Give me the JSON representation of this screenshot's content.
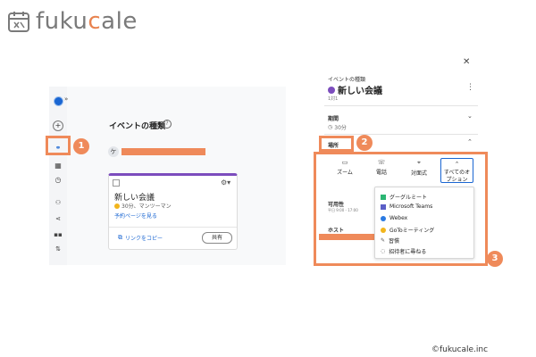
{
  "brand": {
    "logo_text_prefix": "fuku",
    "logo_text_accent": "c",
    "logo_text_suffix": "ale",
    "accent_color": "#ef8a5a",
    "copyright": "©fukucale.inc"
  },
  "left": {
    "page_title": "イベントの種類",
    "avatar_initial": "ケ",
    "card": {
      "title": "新しい会議",
      "meta": "30分、マンツーマン",
      "booking_link": "予約ページを見る",
      "copy_link": "リンクをコピー",
      "share_button": "共有",
      "accent_color": "#7c4dbd"
    },
    "rail_icons": [
      "avatar-icon",
      "plus-icon",
      "link-icon",
      "calendar-icon",
      "clock-icon",
      "people-icon",
      "share-icon",
      "apps-icon",
      "settings-icon"
    ]
  },
  "right": {
    "event_type_label": "イベントの種類",
    "event_title": "新しい会議",
    "event_sub": "1対1",
    "duration_label": "期間",
    "duration_value": "30分",
    "location_label": "場所",
    "options": [
      {
        "icon": "video-icon",
        "label": "ズーム"
      },
      {
        "icon": "phone-icon",
        "label": "電話"
      },
      {
        "icon": "pin-icon",
        "label": "対面式"
      },
      {
        "icon": "chevron-up-icon",
        "label": "すべてのオプション"
      }
    ],
    "availability_label": "可用性",
    "availability_sub": "平日 9:00 - 17:00",
    "host_label": "ホスト",
    "dropdown": [
      {
        "icon": "meet-icon",
        "label": "グーグルミート",
        "color": "#2bb673"
      },
      {
        "icon": "teams-icon",
        "label": "Microsoft Teams",
        "color": "#5b5fc7"
      },
      {
        "icon": "webex-icon",
        "label": "Webex",
        "color": "#2a7ae2"
      },
      {
        "icon": "goto-icon",
        "label": "GoToミーティング",
        "color": "#f2b51c"
      },
      {
        "icon": "pencil-icon",
        "label": "習慣",
        "color": "#555555"
      },
      {
        "icon": "chat-icon",
        "label": "招待者に尋ねる",
        "color": "#555555"
      }
    ]
  },
  "badges": [
    "1",
    "2",
    "3"
  ]
}
